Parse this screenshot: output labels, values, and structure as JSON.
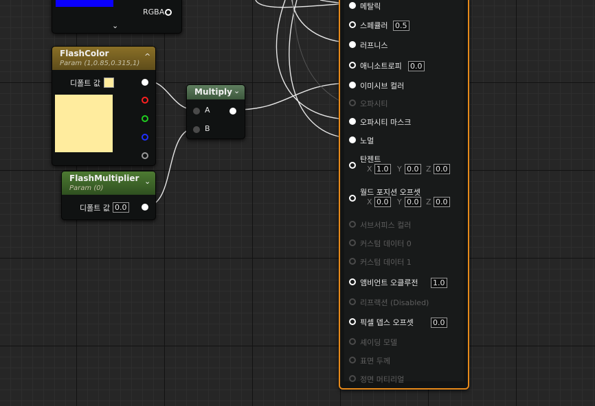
{
  "top_node": {
    "output_label": "RGBA",
    "swatch_color": "#0a00ff",
    "expand_icon": "chevron-down-icon"
  },
  "flash_color": {
    "title": "FlashColor",
    "subtitle": "Param (1,0.85,0.315,1)",
    "default_label": "디폴트 값",
    "swatch_color": "#ffec9e",
    "header_color": "#7a6322",
    "pin_colors": [
      "#ffffff",
      "#ff2020",
      "#20d020",
      "#2030ff",
      "#9a9a9a"
    ]
  },
  "flash_multiplier": {
    "title": "FlashMultiplier",
    "subtitle": "Param (0)",
    "default_label": "디폴트 값",
    "default_value": "0.0",
    "header_color": "#3f6a2a"
  },
  "multiply": {
    "title": "Multiply",
    "input_a": "A",
    "input_b": "B",
    "header_color": "#4f6b4f"
  },
  "material": {
    "accent_color": "#e88a1a",
    "pins": [
      {
        "label": "메탈릭",
        "value": "",
        "active": true,
        "connected": true
      },
      {
        "label": "스페큘러",
        "value": "0.5",
        "active": true,
        "connected": false
      },
      {
        "label": "러프니스",
        "value": "",
        "active": true,
        "connected": true
      },
      {
        "label": "애니소트로피",
        "value": "0.0",
        "active": true,
        "connected": false
      },
      {
        "label": "이미시브 컬러",
        "value": "",
        "active": true,
        "connected": true
      },
      {
        "label": "오파시티",
        "value": "",
        "active": false,
        "connected": false
      },
      {
        "label": "오파시티 마스크",
        "value": "",
        "active": true,
        "connected": true
      },
      {
        "label": "노멀",
        "value": "",
        "active": true,
        "connected": true
      }
    ],
    "tangent": {
      "label": "탄젠트",
      "x_label": "X",
      "x": "1.0",
      "y_label": "Y",
      "y": "0.0",
      "z_label": "Z",
      "z": "0.0"
    },
    "wpo": {
      "label": "월드 포지션 오프셋",
      "x_label": "X",
      "x": "0.0",
      "y_label": "Y",
      "y": "0.0",
      "z_label": "Z",
      "z": "0.0"
    },
    "lower_pins": [
      {
        "label": "서브서피스 컬러",
        "value": "",
        "active": false
      },
      {
        "label": "커스텀 데이터 0",
        "value": "",
        "active": false
      },
      {
        "label": "커스텀 데이터 1",
        "value": "",
        "active": false
      },
      {
        "label": "앰비언트 오클루전",
        "value": "1.0",
        "active": true
      },
      {
        "label": "리프랙션 (Disabled)",
        "value": "",
        "active": false
      },
      {
        "label": "픽셀 뎁스 오프셋",
        "value": "0.0",
        "active": true
      },
      {
        "label": "셰이딩 모델",
        "value": "",
        "active": false
      },
      {
        "label": "표면 두께",
        "value": "",
        "active": false
      },
      {
        "label": "정면 머티리얼",
        "value": "",
        "active": false
      }
    ]
  }
}
